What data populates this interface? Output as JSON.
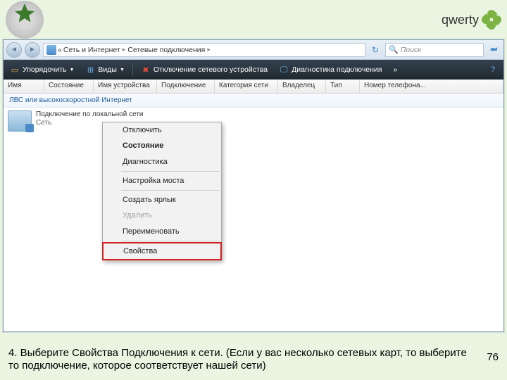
{
  "brand": {
    "name": "qwerty"
  },
  "addressbar": {
    "segments": [
      "«",
      "Сеть и Интернет",
      "Сетевые подключения"
    ],
    "search_placeholder": "Поиск"
  },
  "toolbar": {
    "organize": "Упорядочить",
    "views": "Виды",
    "disable": "Отключение сетевого устройства",
    "diagnose": "Диагностика подключения",
    "more": "»"
  },
  "columns": [
    "Имя",
    "Состояние",
    "Имя устройства",
    "Подключение",
    "Категория сети",
    "Владелец",
    "Тип",
    "Номер телефона..."
  ],
  "group_label": "ЛВС или высокоскоростной Интернет",
  "item": {
    "title": "Подключение по локальной сети",
    "sub": "Сеть"
  },
  "context_menu": {
    "disable": "Отключить",
    "status": "Состояние",
    "diagnose": "Диагностика",
    "bridge": "Настройка моста",
    "shortcut": "Создать ярлык",
    "delete": "Удалить",
    "rename": "Переименовать",
    "properties": "Свойства"
  },
  "caption": {
    "text": "4. Выберите Свойства Подключения к сети. (Если у вас несколько сетевых карт, то выберите то подключение, которое соответствует нашей сети)",
    "page": "76"
  }
}
